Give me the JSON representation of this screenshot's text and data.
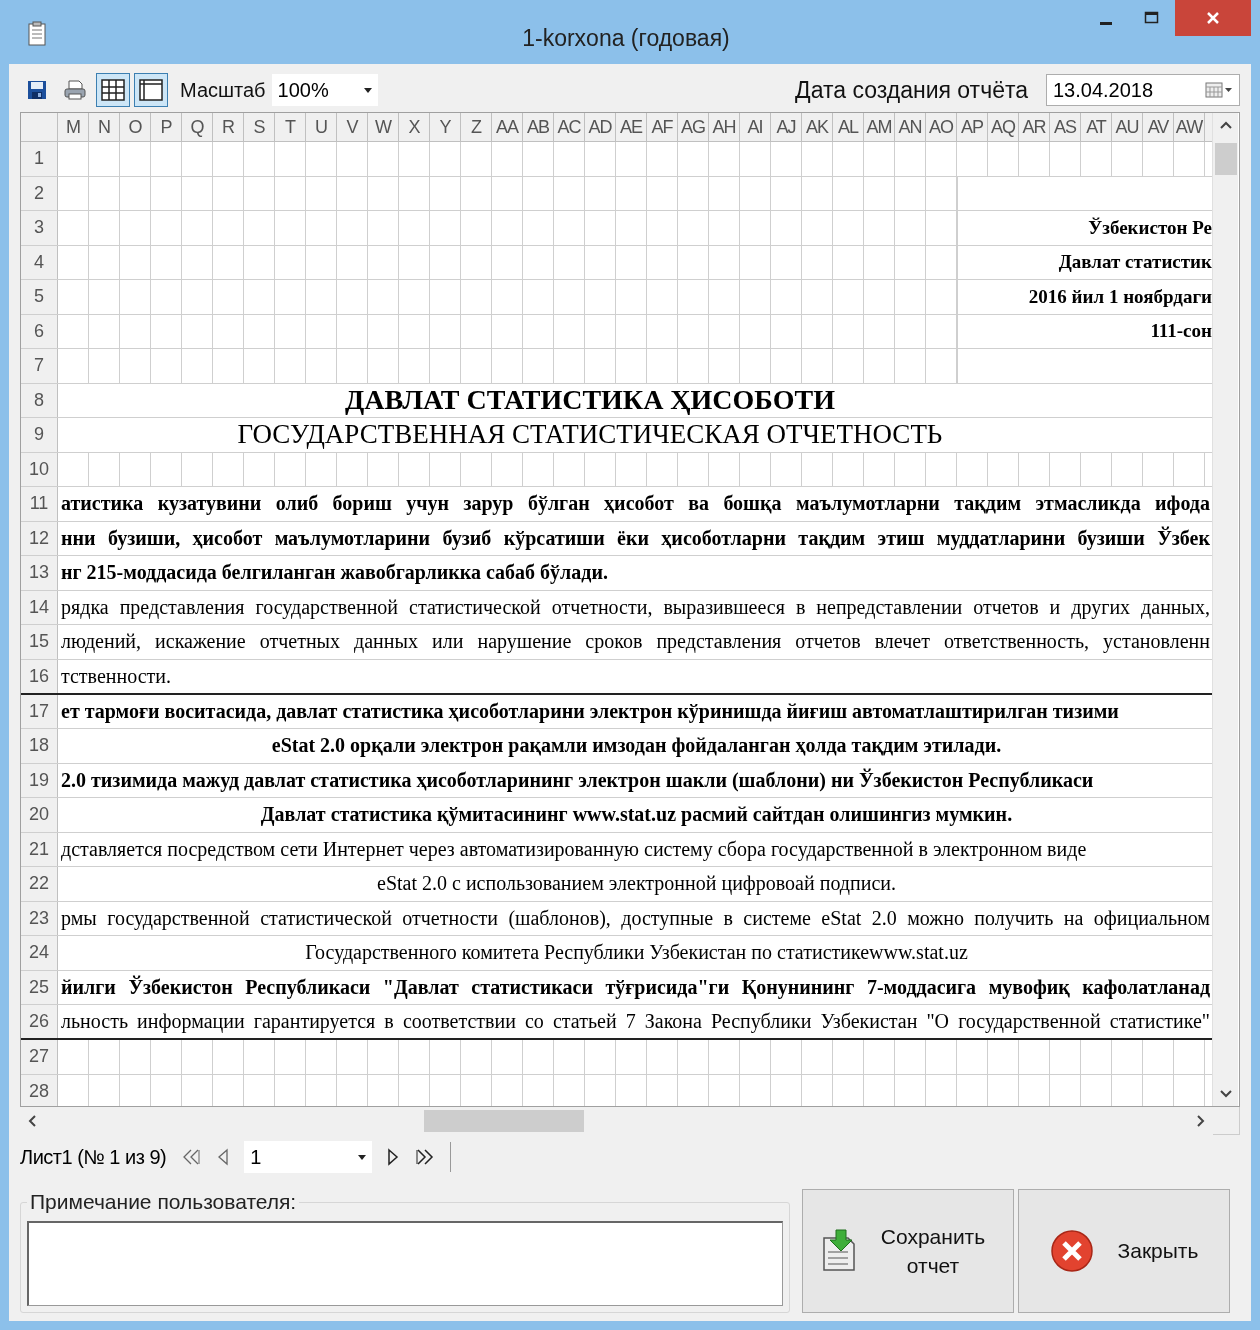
{
  "window": {
    "title": "1-korxona (годовая)"
  },
  "toolbar": {
    "buttons": [
      {
        "kind": "save",
        "selected": false
      },
      {
        "kind": "print",
        "selected": false
      },
      {
        "kind": "grid",
        "selected": true
      },
      {
        "kind": "page",
        "selected": true
      }
    ],
    "zoom": {
      "label": "Масштаб",
      "value": "100%"
    },
    "date": {
      "label": "Дата создания отчёта",
      "value": "13.04.2018"
    }
  },
  "sheet": {
    "columns": [
      "M",
      "N",
      "O",
      "P",
      "Q",
      "R",
      "S",
      "T",
      "U",
      "V",
      "W",
      "X",
      "Y",
      "Z",
      "AA",
      "AB",
      "AC",
      "AD",
      "AE",
      "AF",
      "AG",
      "AH",
      "AI",
      "AJ",
      "AK",
      "AL",
      "AM",
      "AN",
      "AO",
      "AP",
      "AQ",
      "AR",
      "AS",
      "AT",
      "AU",
      "AV",
      "AW"
    ],
    "rows": [
      {
        "number": "1",
        "kind": "grid"
      },
      {
        "number": "2",
        "kind": "side"
      },
      {
        "number": "3",
        "kind": "side",
        "text": "Ўзбекистон Ре"
      },
      {
        "number": "4",
        "kind": "side",
        "text": "Давлат статистик"
      },
      {
        "number": "5",
        "kind": "side",
        "text": "2016 йил 1 ноябрдаги"
      },
      {
        "number": "6",
        "kind": "side",
        "text": "111-сон"
      },
      {
        "number": "7",
        "kind": "side"
      },
      {
        "number": "8",
        "kind": "title",
        "text": "ДАВЛАТ СТАТИСТИКА ҲИСОБОТИ"
      },
      {
        "number": "9",
        "kind": "subtitle",
        "text": "ГОСУДАРСТВЕННАЯ СТАТИСТИЧЕСКАЯ ОТЧЕТНОСТЬ"
      },
      {
        "number": "10",
        "kind": "grid"
      },
      {
        "number": "11",
        "kind": "text",
        "bold": true,
        "justified": true,
        "centered": false,
        "text": "атистика  кузатувини олиб  бориш учун зарур бўлган ҳисобот ва бошқа маълумотларни тақдим этмасликда ифода"
      },
      {
        "number": "12",
        "kind": "text",
        "bold": true,
        "justified": true,
        "centered": false,
        "text": "нни бузиши, ҳисобот маълумотларини бузиб  кўрсатиши ёки ҳисоботларни тақдим этиш муддатларини бузиши Ўзбек"
      },
      {
        "number": "13",
        "kind": "text",
        "bold": true,
        "justified": false,
        "centered": false,
        "text": "нг 215-моддасида белгиланган  жавобгарликка сабаб бўлади."
      },
      {
        "number": "14",
        "kind": "text",
        "bold": false,
        "justified": true,
        "centered": false,
        "text": "рядка представления государственной статистической отчетности, выразившееся в непредставлении отчетов и других данных,"
      },
      {
        "number": "15",
        "kind": "text",
        "bold": false,
        "justified": true,
        "centered": false,
        "text": "людений, искажение отчетных данных или нарушение сроков представления отчетов влечет ответственность, установленн"
      },
      {
        "number": "16",
        "kind": "text",
        "bold": false,
        "justified": false,
        "centered": false,
        "rule": true,
        "text": "тственности."
      },
      {
        "number": "17",
        "kind": "text",
        "bold": true,
        "justified": false,
        "centered": false,
        "text": "ет тармоғи воситасида, давлат статистика ҳисоботларини электрон кўринишда йиғиш автоматлаштирилган тизими"
      },
      {
        "number": "18",
        "kind": "text",
        "bold": true,
        "justified": false,
        "centered": true,
        "text": "eStat 2.0 орқали электрон рақамли имзодан фойдаланган ҳолда тақдим этилади."
      },
      {
        "number": "19",
        "kind": "text",
        "bold": true,
        "justified": false,
        "centered": false,
        "text": "2.0 тизимида мажуд давлат статистика ҳисоботларининг электрон шакли (шаблони) ни Ўзбекистон Республикаси"
      },
      {
        "number": "20",
        "kind": "text",
        "bold": true,
        "justified": false,
        "centered": true,
        "text": "Давлат статистика қўмитасининг www.stat.uz расмий сайтдан олишингиз мумкин."
      },
      {
        "number": "21",
        "kind": "text",
        "bold": false,
        "justified": false,
        "centered": false,
        "text": "дставляется посредством сети Интернет через автоматизированную систему сбора государственной в электронном виде"
      },
      {
        "number": "22",
        "kind": "text",
        "bold": false,
        "justified": false,
        "centered": true,
        "text": "eStat 2.0 с использованием электронной цифровоай подписи."
      },
      {
        "number": "23",
        "kind": "text",
        "bold": false,
        "justified": true,
        "centered": false,
        "text": "рмы государственной статистической отчетности (шаблонов), доступные в системе eStat 2.0 можно получить на официальном"
      },
      {
        "number": "24",
        "kind": "text",
        "bold": false,
        "justified": false,
        "centered": true,
        "text": "Государственного комитета Республики Узбекистан по статистикеwww.stat.uz"
      },
      {
        "number": "25",
        "kind": "text",
        "bold": true,
        "justified": true,
        "centered": false,
        "text": "йилги Ўзбекистон Республикаси \"Давлат статистикаси тўғрисида\"ги Қонунининг 7-моддасига мувофиқ кафолатланад"
      },
      {
        "number": "26",
        "kind": "text",
        "bold": false,
        "justified": true,
        "centered": false,
        "rule": true,
        "text": "льность информации гарантируется в соответствии со статьей 7 Закона Республики Узбекистан \"О государственной статистике\""
      },
      {
        "number": "27",
        "kind": "grid"
      },
      {
        "number": "28",
        "kind": "grid"
      }
    ]
  },
  "sheet_nav": {
    "label": "Лист1 (№ 1 из 9)",
    "page": "1"
  },
  "note": {
    "label": "Примечание пользователя:"
  },
  "buttons": [
    {
      "kind": "save",
      "label": "Сохранить отчет"
    },
    {
      "kind": "close",
      "label": "Закрыть"
    }
  ]
}
